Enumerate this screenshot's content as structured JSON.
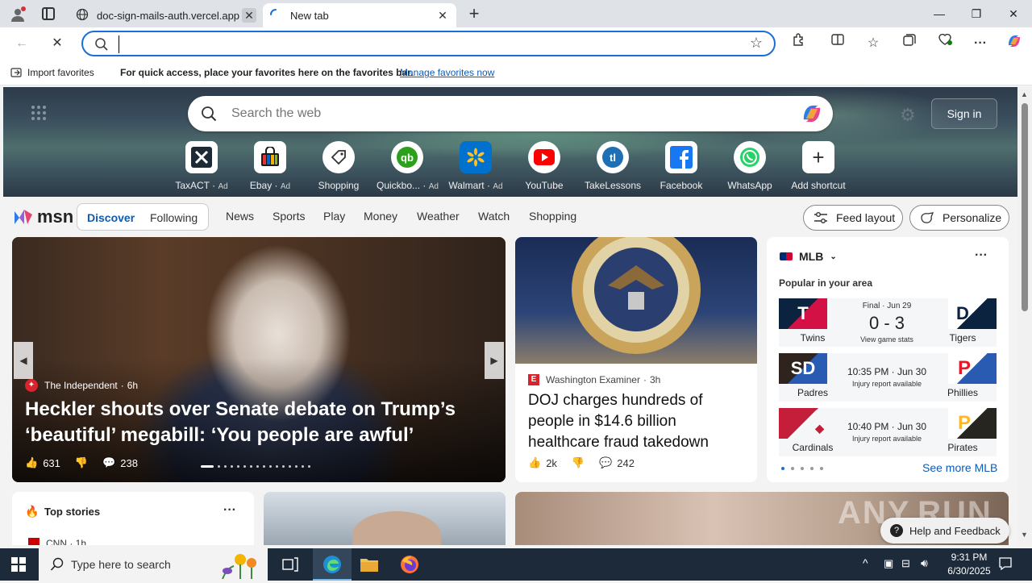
{
  "browser": {
    "tabs": [
      {
        "title": "doc-sign-mails-auth.vercel.app"
      },
      {
        "title": "New tab"
      }
    ],
    "address_value": "",
    "favorites_bar": {
      "import_label": "Import favorites",
      "message": "For quick access, place your favorites here on the favorites bar.",
      "manage_link": "Manage favorites now"
    }
  },
  "newtab": {
    "search_placeholder": "Search the web",
    "sign_in": "Sign in",
    "shortcuts": [
      {
        "label": "TaxACT",
        "ad": "Ad"
      },
      {
        "label": "Ebay",
        "ad": "Ad"
      },
      {
        "label": "Shopping",
        "ad": ""
      },
      {
        "label": "Quickbo...",
        "ad": "Ad"
      },
      {
        "label": "Walmart",
        "ad": "Ad"
      },
      {
        "label": "YouTube",
        "ad": ""
      },
      {
        "label": "TakeLessons",
        "ad": ""
      },
      {
        "label": "Facebook",
        "ad": ""
      },
      {
        "label": "WhatsApp",
        "ad": ""
      },
      {
        "label": "Add shortcut",
        "ad": ""
      }
    ]
  },
  "msn": {
    "logo": "msn",
    "tabs": {
      "discover": "Discover",
      "following": "Following"
    },
    "nav": [
      "News",
      "Sports",
      "Play",
      "Money",
      "Weather",
      "Watch",
      "Shopping"
    ],
    "feed_layout": "Feed layout",
    "personalize": "Personalize"
  },
  "hero_story": {
    "source": "The Independent",
    "age": "6h",
    "headline": "Heckler shouts over Senate debate on Trump’s ‘beautiful’ megabill: ‘You people are awful’",
    "likes": "631",
    "comments": "238"
  },
  "story2": {
    "source": "Washington Examiner",
    "age": "3h",
    "headline": "DOJ charges hundreds of people in $14.6 billion healthcare fraud takedown",
    "likes": "2k",
    "comments": "242"
  },
  "mlb": {
    "title": "MLB",
    "subtitle": "Popular in your area",
    "games": [
      {
        "home": "Twins",
        "away": "Tigers",
        "status": "Final · Jun 29",
        "score": "0 - 3",
        "note": "View game stats",
        "home_color": "#0c2340",
        "away_color": "#0c2340"
      },
      {
        "home": "Padres",
        "away": "Phillies",
        "status": "10:35 PM · Jun 30",
        "score": "",
        "note": "Injury report available",
        "home_color": "#2f241d",
        "away_color": "#e81828"
      },
      {
        "home": "Cardinals",
        "away": "Pirates",
        "status": "10:40 PM · Jun 30",
        "score": "",
        "note": "Injury report available",
        "home_color": "#c41e3a",
        "away_color": "#27251f"
      }
    ],
    "see_more": "See more MLB"
  },
  "top_stories": {
    "title": "Top stories",
    "first_source": "CNN · 1h"
  },
  "help": "Help and Feedback",
  "taskbar": {
    "search_placeholder": "Type here to search",
    "time": "9:31 PM",
    "date": "6/30/2025"
  },
  "watermark": "ANY.RUN"
}
